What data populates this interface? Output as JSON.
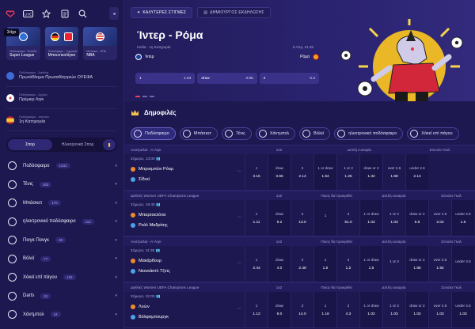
{
  "topbar": {
    "live_label": "LIVE",
    "collapse": "◂"
  },
  "tooltip": "Στίχο",
  "league_tiles": [
    {
      "label": "Super League",
      "sub": "Ποδόσφαιρο · Ελλάδα"
    },
    {
      "label": "Μπουντεσλίγκα",
      "sub": "Ποδόσφαιρο · Γερμανία"
    },
    {
      "label": "NBA",
      "sub": "Μπάσκετ · ΗΠΑ"
    }
  ],
  "favorites": [
    {
      "sub": "Ποδόσφαιρο - Διεθνής",
      "label": "Πρωτάθλημα Πρωταθλητριών ΟΥΕΦΑ",
      "color": "#3c6bd6"
    },
    {
      "sub": "Ποδόσφαιρο - Αγγλία",
      "label": "Πρέμιερ Λιγκ",
      "color": "#e33b3b"
    },
    {
      "sub": "Ποδόσφαιρο - Ισπανία",
      "label": "1η Κατηγορία",
      "color": "#f2c23a"
    }
  ],
  "mode": {
    "live": "Σπορ",
    "esports": "Ηλεκτρονικά Σπορ"
  },
  "sports": [
    {
      "name": "Ποδόσφαιρο",
      "count": "1431"
    },
    {
      "name": "Τένις",
      "count": "263"
    },
    {
      "name": "Μπάσκετ",
      "count": "176"
    },
    {
      "name": "ηλεκτρονικό ποδόσφαιρο",
      "count": "112"
    },
    {
      "name": "Πινγκ Πονγκ",
      "count": "48"
    },
    {
      "name": "Βόλεϊ",
      "count": "77"
    },
    {
      "name": "Χόκεϊ επί πάγου",
      "count": "126"
    },
    {
      "name": "Darts",
      "count": "31"
    },
    {
      "name": "Χάντμπολ",
      "count": "24"
    }
  ],
  "hero_tabs": [
    {
      "label": "ΚΑΛΥΤΕΡΕΣ ΣΤΙΓΜΕΣ"
    },
    {
      "label": "ΔΗΜΙΟΥΡΓΟΣ ΕΚΔΗΛΩΣΗΣ"
    }
  ],
  "hero": {
    "title": "Ίντερ - Ρόμα",
    "meta": "Ιταλία · 1η Κατηγορία",
    "datetime": "5 Απρ, 21:45",
    "home": "Ίντερ",
    "away": "Ρόμα",
    "odds": [
      {
        "label": "1",
        "value": "1.63"
      },
      {
        "label": "draw",
        "value": "3.85"
      },
      {
        "label": "2",
        "value": "5.2"
      }
    ]
  },
  "popular_title": "Δημοφιλές",
  "pills": [
    "Ποδόσφαιρο",
    "Μπάσκετ",
    "Τένις",
    "Χάντμπολ",
    "Βόλεϊ",
    "ηλεκτρονικό ποδόσφαιρο",
    "Χόκεϊ επί πάγου"
  ],
  "matches": [
    {
      "competition": "Αυστραλία - Α-Λιγκ",
      "groups": [
        "1x2",
        "Διπλή ευκαιρία",
        "Σύνολο Γκολ"
      ],
      "time": "Σήμερα, 13:00",
      "home": "Μπρισμπέιν Ρόαρ",
      "away": "Σίδνεϊ",
      "odds": [
        {
          "l": "1",
          "v": "3.15"
        },
        {
          "l": "draw",
          "v": "3.55"
        },
        {
          "l": "2",
          "v": "2.14"
        },
        {
          "l": "1 or draw",
          "v": "1.64"
        },
        {
          "l": "1 or 2",
          "v": "1.25"
        },
        {
          "l": "draw or 2",
          "v": "1.32"
        },
        {
          "l": "over 2.5",
          "v": "1.68"
        },
        {
          "l": "under 2.5",
          "v": "2.14"
        }
      ]
    },
    {
      "competition": "Διεθνές Women UEFA Champions League",
      "groups": [
        "1x2",
        "Ποιος θα προκριθεί",
        "Διπλή ευκαιρία",
        "Σύνολο Γκολ"
      ],
      "time": "Σήμερα, 19:45",
      "home": "Μπαρτσελόνα",
      "away": "Ρεάλ Μαδρίτης",
      "odds": [
        {
          "l": "1",
          "v": "1.11"
        },
        {
          "l": "draw",
          "v": "9.2"
        },
        {
          "l": "2",
          "v": "13.0"
        },
        {
          "l": "1",
          "v": ""
        },
        {
          "l": "2",
          "v": "51.0"
        },
        {
          "l": "1 or draw",
          "v": "1.02"
        },
        {
          "l": "1 or 2",
          "v": "1.03"
        },
        {
          "l": "draw or 2",
          "v": "5.8"
        },
        {
          "l": "over 4.5",
          "v": "2.02"
        },
        {
          "l": "under 4.5",
          "v": "1.6"
        }
      ]
    },
    {
      "competition": "Αυστραλία - Α-Λιγκ",
      "groups": [
        "1x2",
        "Ποιος θα προκριθεί",
        "Διπλή ευκαιρία",
        "Σύνολο Γκολ"
      ],
      "time": "Σήμερα, 11:35",
      "home": "Μακάρθουρ",
      "away": "Νιουκάστλ Τζετς",
      "odds": [
        {
          "l": "1",
          "v": "2.44"
        },
        {
          "l": "draw",
          "v": "4.0"
        },
        {
          "l": "2",
          "v": "2.48"
        },
        {
          "l": "1",
          "v": "1.5"
        },
        {
          "l": "2",
          "v": "1.2"
        },
        {
          "l": "1 or draw",
          "v": "1.5"
        },
        {
          "l": "1 or 2",
          "v": ""
        },
        {
          "l": "draw or 2",
          "v": "1.85"
        },
        {
          "l": "over 3.5",
          "v": "1.92"
        },
        {
          "l": "under 3.5",
          "v": ""
        }
      ]
    },
    {
      "competition": "Διεθνές Women UEFA Champions League",
      "groups": [
        "1x2",
        "Ποιος θα προκριθεί",
        "Διπλή ευκαιρία",
        "Σύνολο Γκολ"
      ],
      "time": "Σήμερα, 22:00",
      "home": "Λυών",
      "away": "Βόλφσμπουργκ",
      "odds": [
        {
          "l": "1",
          "v": "1.12"
        },
        {
          "l": "draw",
          "v": "8.0"
        },
        {
          "l": "2",
          "v": "14.0"
        },
        {
          "l": "1",
          "v": "1.18"
        },
        {
          "l": "2",
          "v": "4.3"
        },
        {
          "l": "1 or draw",
          "v": "1.02"
        },
        {
          "l": "1 or 2",
          "v": "1.03"
        },
        {
          "l": "draw or 2",
          "v": "1.02"
        },
        {
          "l": "over 4.5",
          "v": "1.03"
        },
        {
          "l": "under 4.5",
          "v": "1.03"
        }
      ]
    }
  ]
}
